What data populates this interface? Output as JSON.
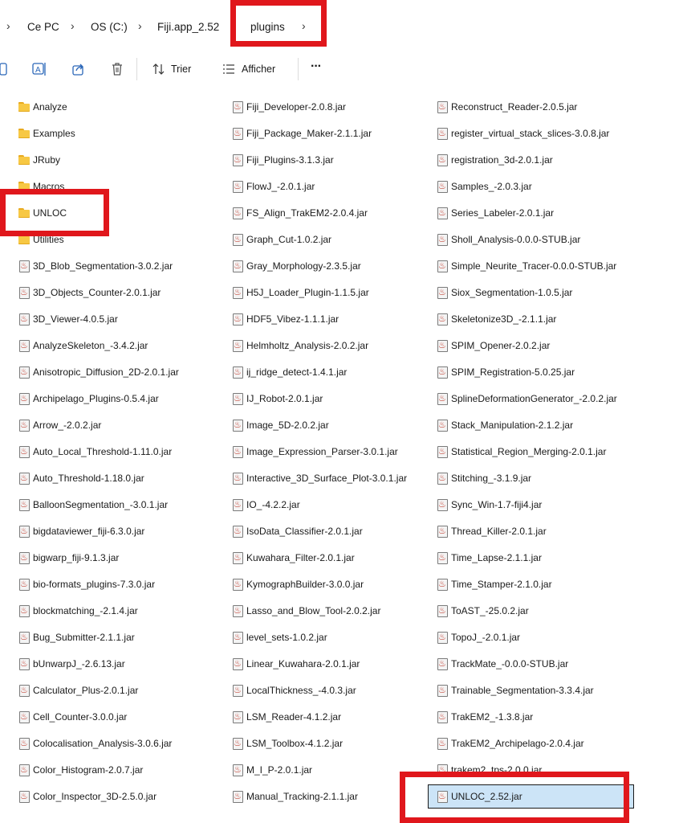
{
  "breadcrumb": {
    "items": [
      "Ce PC",
      "OS (C:)",
      "Fiji.app_2.52",
      "plugins"
    ]
  },
  "toolbar": {
    "sort_label": "Trier",
    "view_label": "Afficher",
    "more_label": "···"
  },
  "columns": [
    [
      {
        "name": "Analyze",
        "type": "folder"
      },
      {
        "name": "Examples",
        "type": "folder"
      },
      {
        "name": "JRuby",
        "type": "folder"
      },
      {
        "name": "Macros",
        "type": "folder"
      },
      {
        "name": "UNLOC",
        "type": "folder"
      },
      {
        "name": "Utilities",
        "type": "folder"
      },
      {
        "name": "3D_Blob_Segmentation-3.0.2.jar",
        "type": "jar"
      },
      {
        "name": "3D_Objects_Counter-2.0.1.jar",
        "type": "jar"
      },
      {
        "name": "3D_Viewer-4.0.5.jar",
        "type": "jar"
      },
      {
        "name": "AnalyzeSkeleton_-3.4.2.jar",
        "type": "jar"
      },
      {
        "name": "Anisotropic_Diffusion_2D-2.0.1.jar",
        "type": "jar"
      },
      {
        "name": "Archipelago_Plugins-0.5.4.jar",
        "type": "jar"
      },
      {
        "name": "Arrow_-2.0.2.jar",
        "type": "jar"
      },
      {
        "name": "Auto_Local_Threshold-1.11.0.jar",
        "type": "jar"
      },
      {
        "name": "Auto_Threshold-1.18.0.jar",
        "type": "jar"
      },
      {
        "name": "BalloonSegmentation_-3.0.1.jar",
        "type": "jar"
      },
      {
        "name": "bigdataviewer_fiji-6.3.0.jar",
        "type": "jar"
      },
      {
        "name": "bigwarp_fiji-9.1.3.jar",
        "type": "jar"
      },
      {
        "name": "bio-formats_plugins-7.3.0.jar",
        "type": "jar"
      },
      {
        "name": "blockmatching_-2.1.4.jar",
        "type": "jar"
      },
      {
        "name": "Bug_Submitter-2.1.1.jar",
        "type": "jar"
      },
      {
        "name": "bUnwarpJ_-2.6.13.jar",
        "type": "jar"
      },
      {
        "name": "Calculator_Plus-2.0.1.jar",
        "type": "jar"
      },
      {
        "name": "Cell_Counter-3.0.0.jar",
        "type": "jar"
      },
      {
        "name": "Colocalisation_Analysis-3.0.6.jar",
        "type": "jar"
      },
      {
        "name": "Color_Histogram-2.0.7.jar",
        "type": "jar"
      },
      {
        "name": "Color_Inspector_3D-2.5.0.jar",
        "type": "jar"
      }
    ],
    [
      {
        "name": "Fiji_Developer-2.0.8.jar",
        "type": "jar"
      },
      {
        "name": "Fiji_Package_Maker-2.1.1.jar",
        "type": "jar"
      },
      {
        "name": "Fiji_Plugins-3.1.3.jar",
        "type": "jar"
      },
      {
        "name": "FlowJ_-2.0.1.jar",
        "type": "jar"
      },
      {
        "name": "FS_Align_TrakEM2-2.0.4.jar",
        "type": "jar"
      },
      {
        "name": "Graph_Cut-1.0.2.jar",
        "type": "jar"
      },
      {
        "name": "Gray_Morphology-2.3.5.jar",
        "type": "jar"
      },
      {
        "name": "H5J_Loader_Plugin-1.1.5.jar",
        "type": "jar"
      },
      {
        "name": "HDF5_Vibez-1.1.1.jar",
        "type": "jar"
      },
      {
        "name": "Helmholtz_Analysis-2.0.2.jar",
        "type": "jar"
      },
      {
        "name": "ij_ridge_detect-1.4.1.jar",
        "type": "jar"
      },
      {
        "name": "IJ_Robot-2.0.1.jar",
        "type": "jar"
      },
      {
        "name": "Image_5D-2.0.2.jar",
        "type": "jar"
      },
      {
        "name": "Image_Expression_Parser-3.0.1.jar",
        "type": "jar"
      },
      {
        "name": "Interactive_3D_Surface_Plot-3.0.1.jar",
        "type": "jar"
      },
      {
        "name": "IO_-4.2.2.jar",
        "type": "jar"
      },
      {
        "name": "IsoData_Classifier-2.0.1.jar",
        "type": "jar"
      },
      {
        "name": "Kuwahara_Filter-2.0.1.jar",
        "type": "jar"
      },
      {
        "name": "KymographBuilder-3.0.0.jar",
        "type": "jar"
      },
      {
        "name": "Lasso_and_Blow_Tool-2.0.2.jar",
        "type": "jar"
      },
      {
        "name": "level_sets-1.0.2.jar",
        "type": "jar"
      },
      {
        "name": "Linear_Kuwahara-2.0.1.jar",
        "type": "jar"
      },
      {
        "name": "LocalThickness_-4.0.3.jar",
        "type": "jar"
      },
      {
        "name": "LSM_Reader-4.1.2.jar",
        "type": "jar"
      },
      {
        "name": "LSM_Toolbox-4.1.2.jar",
        "type": "jar"
      },
      {
        "name": "M_I_P-2.0.1.jar",
        "type": "jar"
      },
      {
        "name": "Manual_Tracking-2.1.1.jar",
        "type": "jar"
      }
    ],
    [
      {
        "name": "Reconstruct_Reader-2.0.5.jar",
        "type": "jar"
      },
      {
        "name": "register_virtual_stack_slices-3.0.8.jar",
        "type": "jar"
      },
      {
        "name": "registration_3d-2.0.1.jar",
        "type": "jar"
      },
      {
        "name": "Samples_-2.0.3.jar",
        "type": "jar"
      },
      {
        "name": "Series_Labeler-2.0.1.jar",
        "type": "jar"
      },
      {
        "name": "Sholl_Analysis-0.0.0-STUB.jar",
        "type": "jar"
      },
      {
        "name": "Simple_Neurite_Tracer-0.0.0-STUB.jar",
        "type": "jar"
      },
      {
        "name": "Siox_Segmentation-1.0.5.jar",
        "type": "jar"
      },
      {
        "name": "Skeletonize3D_-2.1.1.jar",
        "type": "jar"
      },
      {
        "name": "SPIM_Opener-2.0.2.jar",
        "type": "jar"
      },
      {
        "name": "SPIM_Registration-5.0.25.jar",
        "type": "jar"
      },
      {
        "name": "SplineDeformationGenerator_-2.0.2.jar",
        "type": "jar"
      },
      {
        "name": "Stack_Manipulation-2.1.2.jar",
        "type": "jar"
      },
      {
        "name": "Statistical_Region_Merging-2.0.1.jar",
        "type": "jar"
      },
      {
        "name": "Stitching_-3.1.9.jar",
        "type": "jar"
      },
      {
        "name": "Sync_Win-1.7-fiji4.jar",
        "type": "jar"
      },
      {
        "name": "Thread_Killer-2.0.1.jar",
        "type": "jar"
      },
      {
        "name": "Time_Lapse-2.1.1.jar",
        "type": "jar"
      },
      {
        "name": "Time_Stamper-2.1.0.jar",
        "type": "jar"
      },
      {
        "name": "ToAST_-25.0.2.jar",
        "type": "jar"
      },
      {
        "name": "TopoJ_-2.0.1.jar",
        "type": "jar"
      },
      {
        "name": "TrackMate_-0.0.0-STUB.jar",
        "type": "jar"
      },
      {
        "name": "Trainable_Segmentation-3.3.4.jar",
        "type": "jar"
      },
      {
        "name": "TrakEM2_-1.3.8.jar",
        "type": "jar"
      },
      {
        "name": "TrakEM2_Archipelago-2.0.4.jar",
        "type": "jar"
      },
      {
        "name": "trakem2_tps-2.0.0.jar",
        "type": "jar"
      },
      {
        "name": "UNLOC_2.52.jar",
        "type": "jar",
        "selected": true
      }
    ]
  ],
  "colors": {
    "highlight_box": "#e0171c",
    "selection_bg": "#cce4f7",
    "toolbar_icon": "#2a66b8"
  }
}
